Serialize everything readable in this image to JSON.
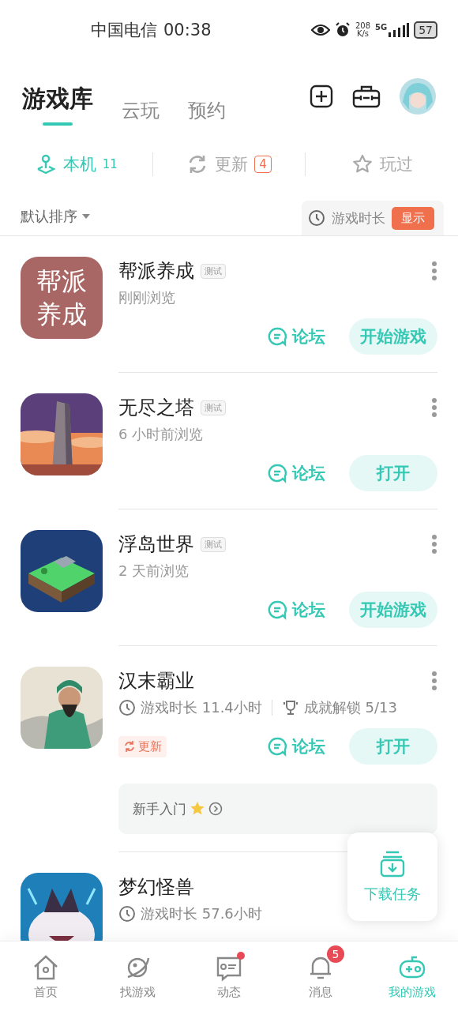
{
  "status_bar": {
    "carrier": "中国电信",
    "time": "00:38",
    "speed_value": "208",
    "speed_unit": "K/s",
    "network": "5G",
    "battery": "57"
  },
  "header_tabs": [
    {
      "label": "游戏库",
      "selected": true
    },
    {
      "label": "云玩",
      "selected": false
    },
    {
      "label": "预约",
      "selected": false
    }
  ],
  "filters": [
    {
      "label": "本机",
      "count": "11",
      "selected": true,
      "kind": "count"
    },
    {
      "label": "更新",
      "count": "4",
      "selected": false,
      "kind": "badge"
    },
    {
      "label": "玩过",
      "selected": false,
      "kind": "plain"
    }
  ],
  "sort": {
    "label": "默认排序",
    "playtime_label": "游戏时长",
    "playtime_button": "显示"
  },
  "games": [
    {
      "name": "帮派养成",
      "more_menu": true,
      "tag": "测试",
      "icon_lines": [
        "帮派",
        "养成"
      ],
      "subtitle": "刚刚浏览",
      "forum": "论坛",
      "action": "开始游戏"
    },
    {
      "name": "无尽之塔",
      "more_menu": true,
      "tag": "测试",
      "subtitle": "6 小时前浏览",
      "forum": "论坛",
      "action": "打开"
    },
    {
      "name": "浮岛世界",
      "more_menu": true,
      "tag": "测试",
      "subtitle": "2 天前浏览",
      "forum": "论坛",
      "action": "开始游戏"
    },
    {
      "name": "汉末霸业",
      "more_menu": true,
      "playtime": "游戏时长 11.4小时",
      "achievements": "成就解锁 5/13",
      "update": "更新",
      "forum": "论坛",
      "action": "打开",
      "guide": "新手入门"
    },
    {
      "name": "梦幻怪兽",
      "more_menu": false,
      "playtime": "游戏时长 57.6小时"
    }
  ],
  "download_tasks": "下载任务",
  "nav": [
    {
      "label": "首页",
      "selected": false
    },
    {
      "label": "找游戏",
      "selected": false
    },
    {
      "label": "动态",
      "selected": false,
      "dot": true
    },
    {
      "label": "消息",
      "selected": false,
      "badge": "5"
    },
    {
      "label": "我的游戏",
      "selected": true
    }
  ]
}
